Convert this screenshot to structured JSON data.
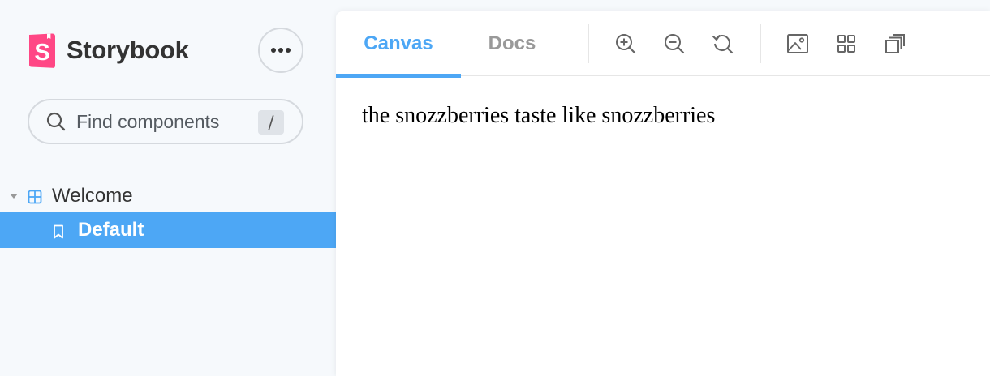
{
  "brand": {
    "name": "Storybook",
    "logo_letter": "S",
    "logo_color": "#ff4785"
  },
  "sidebar": {
    "menu_icon": "ellipsis-icon",
    "search": {
      "placeholder": "Find components",
      "value": "",
      "shortcut": "/",
      "icon": "search-icon"
    },
    "tree": [
      {
        "label": "Welcome",
        "icon": "component-icon",
        "expanded": true,
        "stories": [
          {
            "label": "Default",
            "icon": "bookmark-icon",
            "selected": true
          }
        ]
      }
    ]
  },
  "toolbar": {
    "tabs": [
      {
        "label": "Canvas",
        "active": true
      },
      {
        "label": "Docs",
        "active": false
      }
    ],
    "tools": [
      "zoom-in-icon",
      "zoom-out-icon",
      "zoom-reset-icon",
      "background-icon",
      "grid-icon",
      "outline-icon"
    ]
  },
  "preview": {
    "text": "the snozzberries taste like snozzberries"
  },
  "colors": {
    "accent": "#4da7f5",
    "brand": "#ff4785",
    "sidebar_bg": "#f6f9fc",
    "text": "#333333",
    "muted": "#999999"
  }
}
